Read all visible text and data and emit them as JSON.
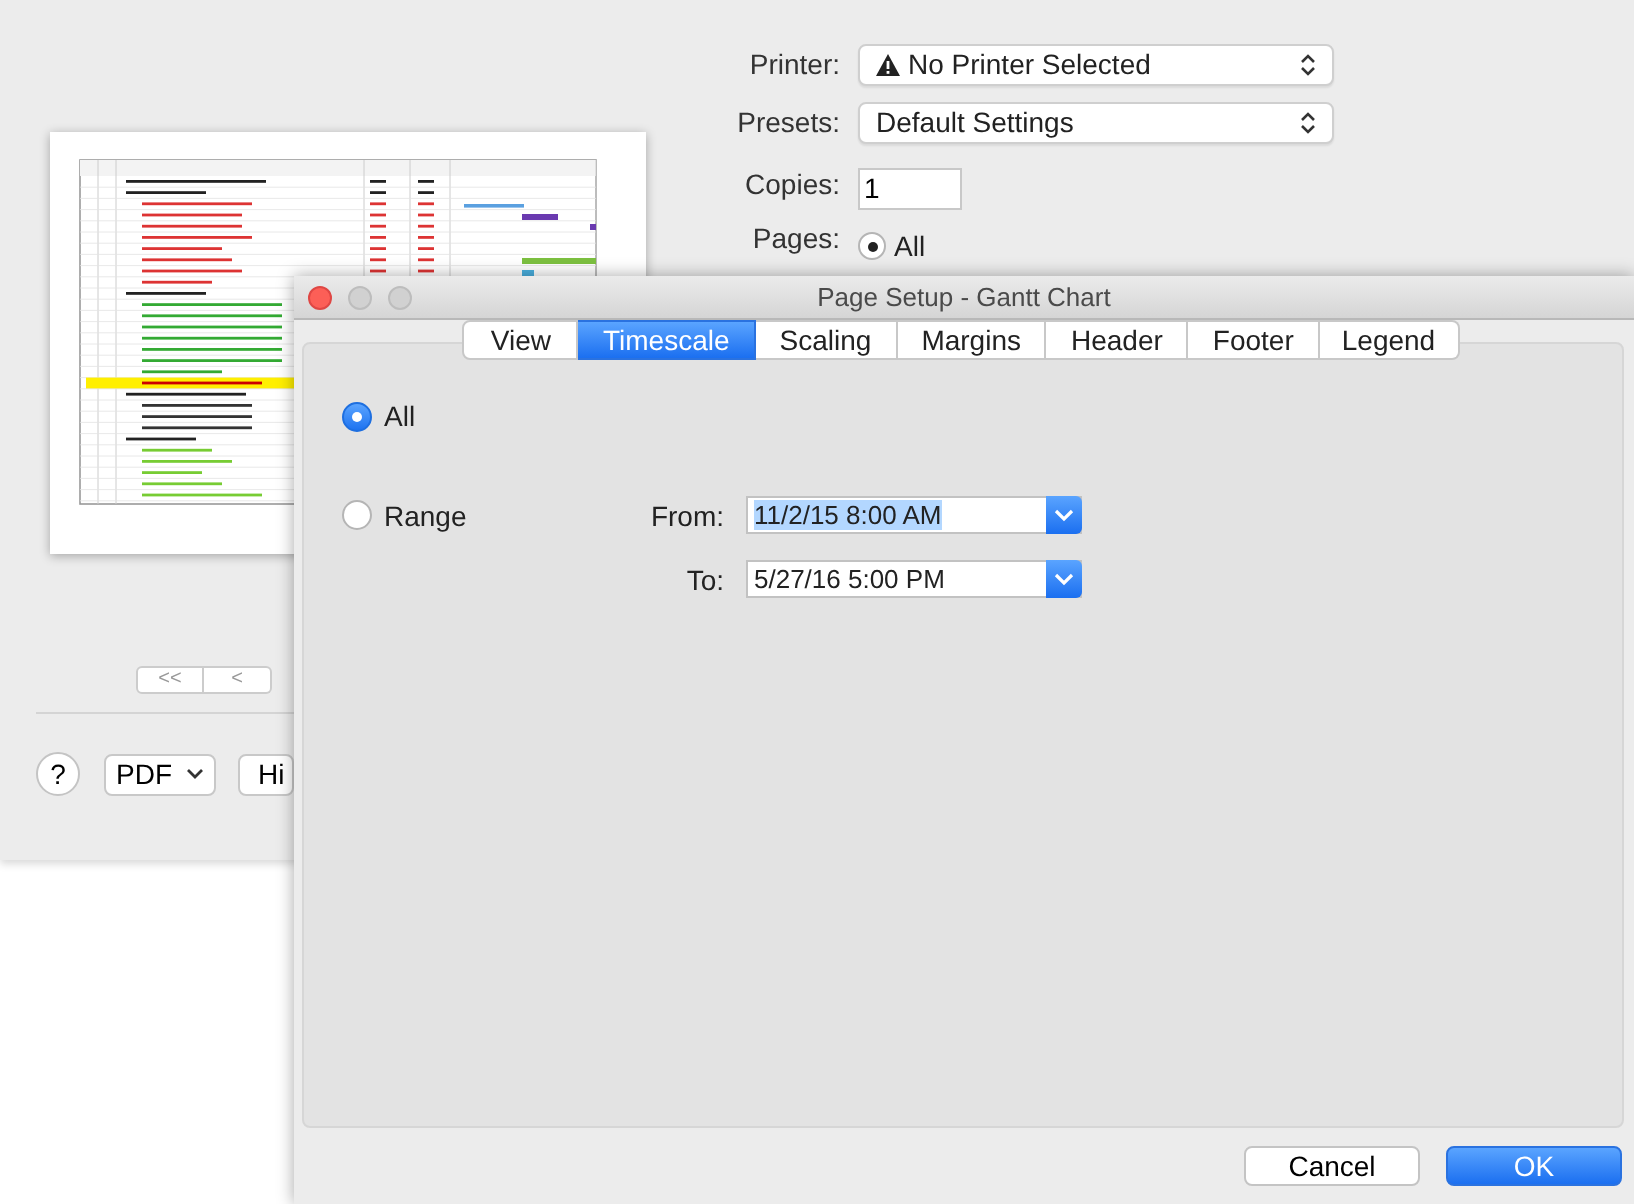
{
  "print_dialog": {
    "nav_buttons": [
      "<<",
      "<"
    ],
    "help_button": "?",
    "pdf_button": "PDF",
    "hide_button": "Hi",
    "fields": [
      {
        "kind": "popup",
        "label": "Printer:",
        "value": "No Printer Selected",
        "warning": true
      },
      {
        "kind": "popup",
        "label": "Presets:",
        "value": "Default Settings",
        "warning": false
      },
      {
        "kind": "field",
        "label": "Copies:",
        "value": "1"
      },
      {
        "kind": "radio",
        "label": "Pages:",
        "value": "All",
        "selected": true
      }
    ]
  },
  "page_setup": {
    "title": "Page Setup - Gantt Chart",
    "tabs": [
      {
        "label": "View",
        "selected": false
      },
      {
        "label": "Timescale",
        "selected": true
      },
      {
        "label": "Scaling",
        "selected": false
      },
      {
        "label": "Margins",
        "selected": false
      },
      {
        "label": "Header",
        "selected": false
      },
      {
        "label": "Footer",
        "selected": false
      },
      {
        "label": "Legend",
        "selected": false
      }
    ],
    "range_options": [
      {
        "label": "All",
        "selected": true
      },
      {
        "label": "Range",
        "selected": false
      }
    ],
    "dates": [
      {
        "label": "From:",
        "value": "11/2/15 8:00 AM",
        "highlighted": true
      },
      {
        "label": "To:",
        "value": "5/27/16 5:00 PM",
        "highlighted": false
      }
    ],
    "buttons": [
      {
        "label": "Cancel",
        "default": false
      },
      {
        "label": "OK",
        "default": true
      }
    ]
  }
}
